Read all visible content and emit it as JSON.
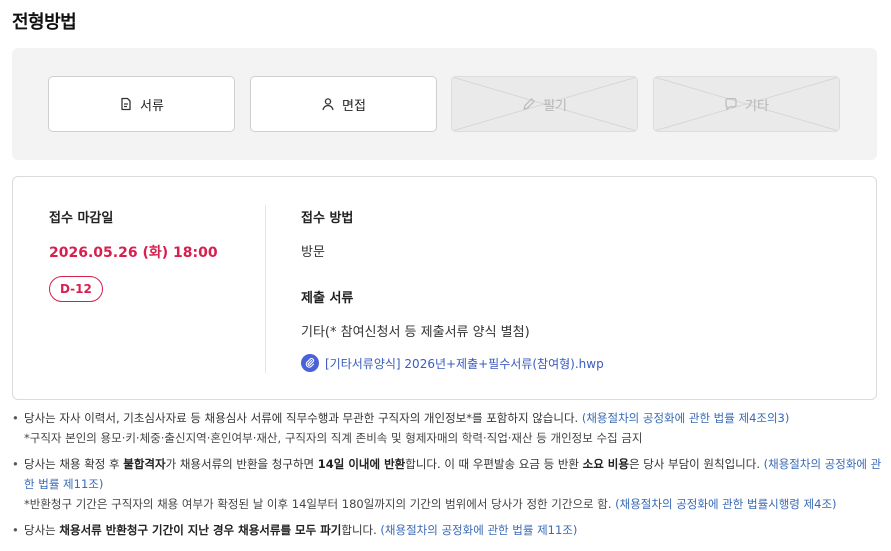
{
  "section_title": "전형방법",
  "steps": [
    {
      "label": "서류",
      "icon": "document-icon",
      "state": "active"
    },
    {
      "label": "면접",
      "icon": "person-icon",
      "state": "active"
    },
    {
      "label": "필기",
      "icon": "pencil-icon",
      "state": "inactive"
    },
    {
      "label": "기타",
      "icon": "chat-bubble-icon",
      "state": "inactive"
    }
  ],
  "deadline": {
    "label": "접수 마감일",
    "date": "2026.05.26 (화) 18:00",
    "dday": "D-12"
  },
  "method": {
    "label": "접수 방법",
    "value": "방문"
  },
  "documents": {
    "label": "제출 서류",
    "value": "기타(* 참여신청서 등 제출서류 양식 별첨)",
    "file_name": "[기타서류양식] 2026년+제출+필수서류(참여형).hwp",
    "file_icon": "attachment-icon"
  },
  "notes": {
    "n1_text": "당사는 자사 이력서, 기초심사자료 등 채용심사 서류에 직무수행과 무관한 구직자의 개인정보*를 포함하지 않습니다.",
    "n1_law": "(채용절차의 공정화에 관한 법률 제4조의3)",
    "n1_sub": "*구직자 본인의 용모·키·체중·출신지역·혼인여부·재산, 구직자의 직계 존비속 및 형제자매의 학력·직업·재산 등 개인정보 수집 금지",
    "n2_a": "당사는 채용 확정 후 ",
    "n2_b": "불합격자",
    "n2_c": "가 채용서류의 반환을 청구하면 ",
    "n2_d": "14일 이내에 반환",
    "n2_e": "합니다. 이 때 우편발송 요금 등 반환 ",
    "n2_f": "소요 비용",
    "n2_g": "은 당사 부담이 원칙입니다.",
    "n2_law": "(채용절차의 공정화에 관한 법률 제11조)",
    "n2_sub_text": "*반환청구 기간은 구직자의 채용 여부가 확정된 날 이후 14일부터 180일까지의 기간의 범위에서 당사가 정한 기간으로 함.",
    "n2_sub_law": "(채용절차의 공정화에 관한 법률시행령 제4조)",
    "n3_a": "당사는 ",
    "n3_b": "채용서류 반환청구 기간이 지난 경우 채용서류를 모두 파기",
    "n3_c": "합니다.",
    "n3_law": "(채용절차의 공정화에 관한 법률 제11조)"
  },
  "colors": {
    "accent_red": "#d6204f",
    "link_blue": "#3a6ab5",
    "panel_gray": "#f3f3f3"
  }
}
